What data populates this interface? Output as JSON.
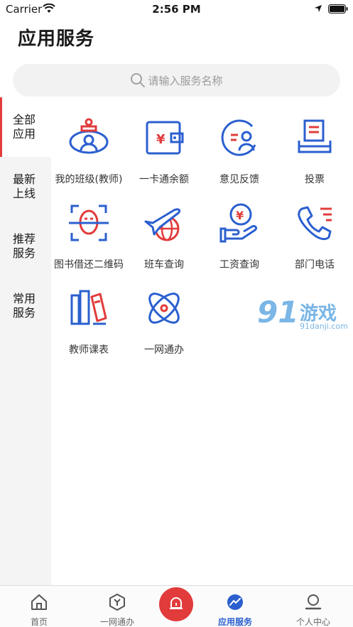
{
  "status_bar": {
    "carrier": "Carrier",
    "time": "2:56 PM"
  },
  "page": {
    "title": "应用服务"
  },
  "search": {
    "placeholder": "请输入服务名称"
  },
  "sidebar": {
    "items": [
      {
        "label": "全部应用",
        "active": true
      },
      {
        "label": "最新上线",
        "active": false
      },
      {
        "label": "推荐服务",
        "active": false
      },
      {
        "label": "常用服务",
        "active": false
      }
    ]
  },
  "services": [
    {
      "label": "我的班级(教师)",
      "icon": "class-icon"
    },
    {
      "label": "一卡通余额",
      "icon": "wallet-icon"
    },
    {
      "label": "意见反馈",
      "icon": "feedback-icon"
    },
    {
      "label": "投票",
      "icon": "vote-icon"
    },
    {
      "label": "图书借还二维码",
      "icon": "face-scan-icon"
    },
    {
      "label": "班车查询",
      "icon": "plane-globe-icon"
    },
    {
      "label": "工资查询",
      "icon": "salary-hand-icon"
    },
    {
      "label": "部门电话",
      "icon": "phone-icon"
    },
    {
      "label": "教师课表",
      "icon": "books-icon"
    },
    {
      "label": "一网通办",
      "icon": "atom-icon"
    }
  ],
  "watermark": {
    "number": "91",
    "name": "游戏",
    "url": "91danji.com"
  },
  "tabbar": {
    "tabs": [
      {
        "label": "首页",
        "icon": "home-icon"
      },
      {
        "label": "一网通办",
        "icon": "hexagon-icon"
      },
      {
        "label": "应用服务",
        "icon": "chart-icon",
        "active": true
      },
      {
        "label": "个人中心",
        "icon": "user-icon"
      }
    ]
  },
  "colors": {
    "accent_blue": "#2b5fcf",
    "accent_red": "#e23b3b"
  }
}
